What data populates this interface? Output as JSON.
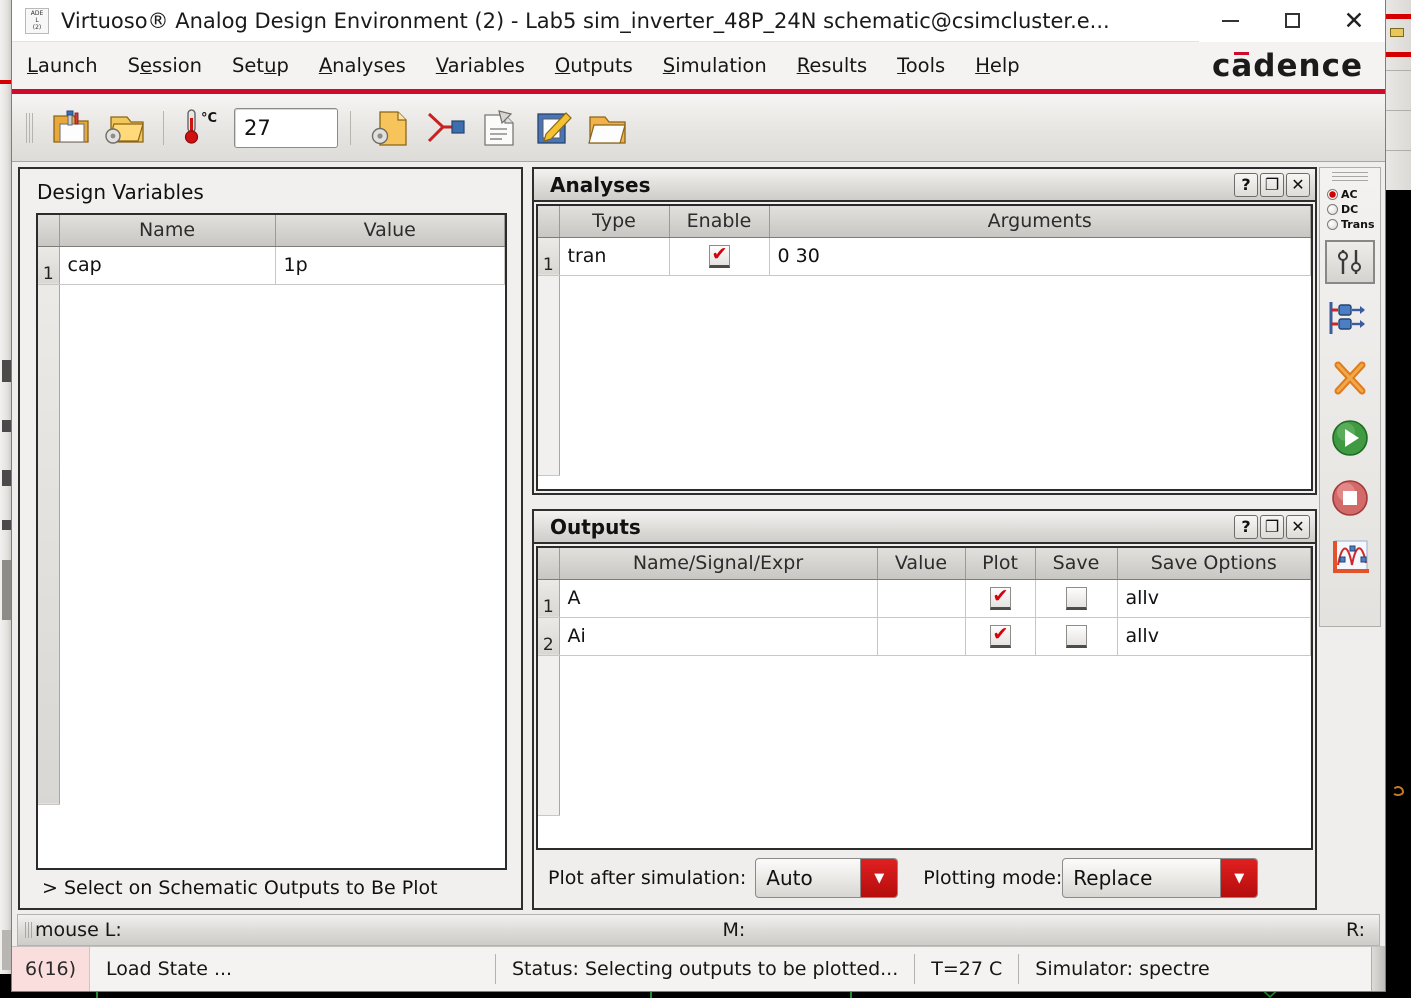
{
  "window": {
    "app_icon_lines": [
      "ADE",
      "L",
      "(2)"
    ],
    "title": "Virtuoso® Analog Design Environment (2) - Lab5 sim_inverter_48P_24N schematic@csimcluster.e...",
    "controls": [
      {
        "name": "minimize",
        "glyph": "—"
      },
      {
        "name": "maximize",
        "glyph": "□"
      },
      {
        "name": "close",
        "glyph": "✕"
      }
    ],
    "accent_red": "#cf0a2c",
    "brand": "cadence"
  },
  "menubar": {
    "items": [
      {
        "label": "Launch",
        "accel": "L"
      },
      {
        "label": "Session",
        "accel": "e"
      },
      {
        "label": "Setup",
        "accel": "u"
      },
      {
        "label": "Analyses",
        "accel": "A"
      },
      {
        "label": "Variables",
        "accel": "V"
      },
      {
        "label": "Outputs",
        "accel": "O"
      },
      {
        "label": "Simulation",
        "accel": "S"
      },
      {
        "label": "Results",
        "accel": "R"
      },
      {
        "label": "Tools",
        "accel": "T"
      },
      {
        "label": "Help",
        "accel": "H"
      }
    ]
  },
  "toolbar": {
    "buttons": [
      {
        "name": "open-state-icon",
        "title": "Open State"
      },
      {
        "name": "save-state-icon",
        "title": "Save State"
      },
      {
        "name": "temperature-icon",
        "title": "Temperature"
      },
      {
        "name": "netlist-options-icon",
        "title": "Netlist and Run Options"
      },
      {
        "name": "parasitics-icon",
        "title": "Parasitics"
      },
      {
        "name": "netlist-view-icon",
        "title": "View Netlist"
      },
      {
        "name": "edit-netlist-icon",
        "title": "Edit Netlist"
      },
      {
        "name": "open-results-icon",
        "title": "Open Results"
      }
    ],
    "temperature_value": "27",
    "temperature_unit": "°C"
  },
  "design_variables": {
    "title": "Design Variables",
    "columns": [
      "Name",
      "Value"
    ],
    "rows": [
      {
        "n": "1",
        "name": "cap",
        "value": "1p"
      }
    ],
    "footer": "> Select on Schematic Outputs to Be Plot"
  },
  "analyses": {
    "title": "Analyses",
    "panel_buttons": [
      "?",
      "❐",
      "✕"
    ],
    "columns": [
      "Type",
      "Enable",
      "Arguments"
    ],
    "rows": [
      {
        "n": "1",
        "type": "tran",
        "enable": true,
        "arguments": "0 30"
      }
    ]
  },
  "outputs": {
    "title": "Outputs",
    "panel_buttons": [
      "?",
      "❐",
      "✕"
    ],
    "columns": [
      "Name/Signal/Expr",
      "Value",
      "Plot",
      "Save",
      "Save Options"
    ],
    "rows": [
      {
        "n": "1",
        "signal": "A",
        "value": "",
        "plot": true,
        "save": false,
        "save_options": "allv"
      },
      {
        "n": "2",
        "signal": "Ai",
        "value": "",
        "plot": true,
        "save": false,
        "save_options": "allv"
      }
    ],
    "plot_after_simulation_label": "Plot after simulation:",
    "plot_after_simulation_value": "Auto",
    "plotting_mode_label": "Plotting mode:",
    "plotting_mode_value": "Replace"
  },
  "right_toolbar": {
    "radios": [
      {
        "label": "AC",
        "selected": true
      },
      {
        "label": "DC",
        "selected": false
      },
      {
        "label": "Trans",
        "selected": false
      }
    ],
    "buttons": [
      {
        "name": "choose-analyses-icon"
      },
      {
        "name": "edit-variables-icon"
      },
      {
        "name": "delete-icon"
      },
      {
        "name": "run-simulation-icon"
      },
      {
        "name": "stop-simulation-icon"
      },
      {
        "name": "plot-outputs-icon"
      }
    ]
  },
  "mousebar": {
    "left": "mouse L:",
    "middle": "M:",
    "right": "R:"
  },
  "statusbar": {
    "error_badge": "6(16)",
    "message": "Load State ...",
    "status": "Status: Selecting   outputs   to   be   plotted...",
    "temperature": "T=27   C",
    "simulator": "Simulator: spectre"
  }
}
